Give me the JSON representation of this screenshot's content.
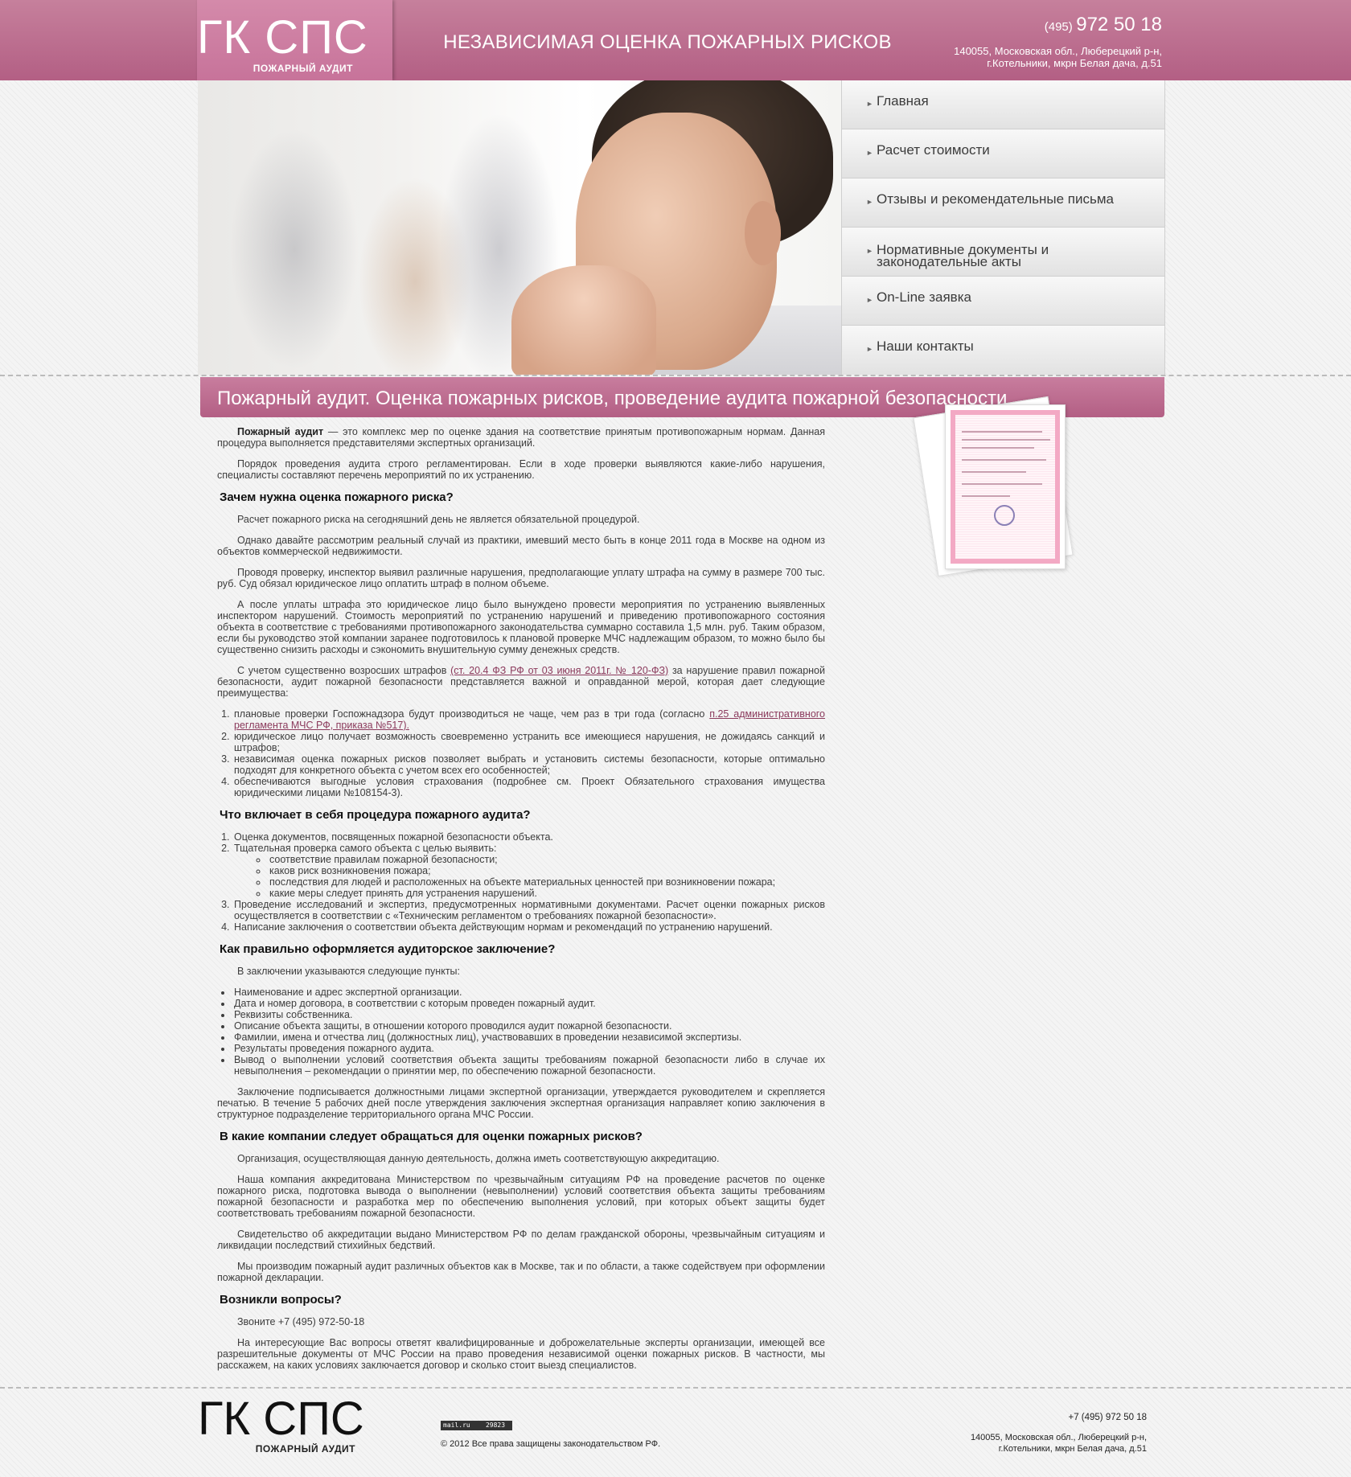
{
  "header": {
    "logo": "ГК СПС",
    "logo_sub": "ПОЖАРНЫЙ АУДИТ",
    "title": "НЕЗАВИСИМАЯ ОЦЕНКА ПОЖАРНЫХ РИСКОВ",
    "phone_code": "(495)",
    "phone_number": "972 50 18",
    "address_line1": "140055, Московская обл., Люберецкий р-н,",
    "address_line2": "г.Котельники, мкрн Белая дача, д.51"
  },
  "nav": {
    "items": [
      {
        "label": "Главная"
      },
      {
        "label": "Расчет стоимости"
      },
      {
        "label": "Отзывы и рекомендательные письма"
      },
      {
        "label": "Нормативные документы и законодательные акты"
      },
      {
        "label": "On-Line заявка"
      },
      {
        "label": "Наши контакты"
      }
    ]
  },
  "content": {
    "title": "Пожарный аудит. Оценка пожарных рисков, проведение аудита пожарной безопасности",
    "intro_bold": "Пожарный аудит",
    "intro_rest": " — это комплекс мер по оценке здания на соответствие принятым противопожарным нормам. Данная процедура выполняется представителями экспертных организаций.",
    "p2": "Порядок проведения аудита строго регламентирован. Если в ходе проверки выявляются какие-либо нарушения, специалисты составляют перечень мероприятий по их устранению.",
    "h1": "Зачем нужна оценка пожарного риска?",
    "p3": "Расчет пожарного риска на сегодняшний день не является обязательной процедурой.",
    "p4": "Однако давайте рассмотрим реальный случай из практики, имевший место быть в конце 2011 года в Москве на одном из объектов коммерческой недвижимости.",
    "p5": "Проводя проверку, инспектор выявил различные нарушения, предполагающие уплату штрафа на сумму в размере 700 тыс. руб. Суд обязал юридическое лицо оплатить штраф в полном объеме.",
    "p6": "А после уплаты штрафа это юридическое лицо было вынуждено провести мероприятия по устранению выявленных инспектором нарушений. Стоимость мероприятий по устранению нарушений и приведению противопожарного состояния объекта в соответствие с требованиями противопожарного законодательства суммарно составила 1,5 млн. руб. Таким образом, если бы руководство этой компании заранее подготовилось к плановой проверке МЧС надлежащим образом, то можно было бы существенно снизить расходы и сэкономить внушительную сумму денежных средств.",
    "p7_a": "С учетом существенно возросших штрафов ",
    "p7_link": "(ст. 20.4 ФЗ РФ от 03 июня 2011г. № 120-ФЗ)",
    "p7_b": " за нарушение правил пожарной безопасности, аудит пожарной безопасности представляется важной и оправданной мерой, которая дает следующие преимущества:",
    "list1": [
      {
        "text": "плановые проверки Госпожнадзора будут производиться не чаще, чем раз в три года (согласно ",
        "link": "п.25 административного регламента МЧС РФ, приказа №517)."
      },
      {
        "text": "юридическое лицо получает возможность своевременно устранить все имеющиеся нарушения, не дожидаясь санкций и штрафов;",
        "link": ""
      },
      {
        "text": "независимая оценка пожарных рисков позволяет выбрать и установить системы безопасности, которые оптимально подходят для конкретного объекта с учетом всех его особенностей;",
        "link": ""
      },
      {
        "text": "обеспечиваются выгодные условия страхования (подробнее см. Проект Обязательного страхования имущества юридическими лицами №108154-3).",
        "link": ""
      }
    ],
    "h2": "Что включает в себя процедура пожарного аудита?",
    "list2_1": "Оценка документов, посвященных пожарной безопасности объекта.",
    "list2_2": "Тщательная проверка самого объекта с целью выявить:",
    "list2_sub": [
      "соответствие правилам пожарной безопасности;",
      "каков риск возникновения пожара;",
      "последствия для людей и расположенных на объекте материальных ценностей при возникновении пожара;",
      "какие меры следует принять для устранения нарушений."
    ],
    "list2_3": "Проведение исследований и экспертиз, предусмотренных нормативными документами. Расчет оценки пожарных рисков осуществляется в соответствии с «Техническим регламентом о требованиях пожарной безопасности».",
    "list2_4": "Написание заключения о соответствии объекта действующим нормам и рекомендаций по устранению нарушений.",
    "h3": "Как правильно оформляется аудиторское заключение?",
    "p8": "В заключении указываются следующие пункты:",
    "list3": [
      "Наименование и адрес экспертной организации.",
      "Дата и номер договора, в соответствии с которым проведен пожарный аудит.",
      "Реквизиты собственника.",
      "Описание объекта защиты, в отношении которого проводился аудит пожарной безопасности.",
      "Фамилии, имена и отчества лиц (должностных лиц), участвовавших в проведении независимой экспертизы.",
      "Результаты проведения пожарного аудита.",
      "Вывод о выполнении условий соответствия объекта защиты требованиям пожарной безопасности либо в случае их невыполнения – рекомендации о принятии мер, по обеспечению пожарной безопасности."
    ],
    "p9": "Заключение подписывается должностными лицами экспертной организации, утверждается руководителем и скрепляется печатью. В течение 5 рабочих дней после утверждения заключения экспертная организация направляет копию заключения в структурное подразделение территориального органа МЧС России.",
    "h4": "В какие компании следует обращаться для оценки пожарных рисков?",
    "p10": "Организация, осуществляющая данную деятельность, должна иметь соответствующую аккредитацию.",
    "p11": "Наша компания аккредитована Министерством по чрезвычайным ситуациям РФ на проведение расчетов по оценке пожарного риска, подготовка вывода о выполнении (невыполнении) условий соответствия объекта защиты требованиям пожарной безопасности и разработка мер по обеспечению выполнения условий, при которых объект защиты будет соответствовать требованиям пожарной безопасности.",
    "p12": "Свидетельство об аккредитации выдано Министерством РФ по делам гражданской обороны, чрезвычайным ситуациям и ликвидации последствий стихийных бедствий.",
    "p13": "Мы производим пожарный аудит различных объектов как в Москве, так и по области, а также содействуем при оформлении пожарной декларации.",
    "h5": "Возникли вопросы?",
    "p14": "Звоните +7 (495) 972-50-18",
    "p15": "На интересующие Вас вопросы ответят квалифицированные и доброжелательные эксперты организации, имеющей все разрешительные документы от МЧС России на право проведения независимой оценки пожарных рисков. В частности, мы расскажем, на каких условиях заключается договор и сколько стоит выезд специалистов."
  },
  "footer": {
    "logo": "ГК СПС",
    "logo_sub": "ПОЖАРНЫЙ АУДИТ",
    "counter_left": "mail.ru",
    "counter_right": "29823",
    "copyright": "© 2012 Все права защищены законодательством РФ.",
    "phone": "+7 (495) 972 50 18",
    "address_line1": "140055, Московская обл., Люберецкий р-н,",
    "address_line2": "г.Котельники, мкрн Белая дача, д.51"
  },
  "icons": {
    "nav_arrow": "arrow-right-icon"
  },
  "colors": {
    "brand": "#b35f84",
    "brand_light": "#d48aaa",
    "link": "#8b3a5c"
  }
}
